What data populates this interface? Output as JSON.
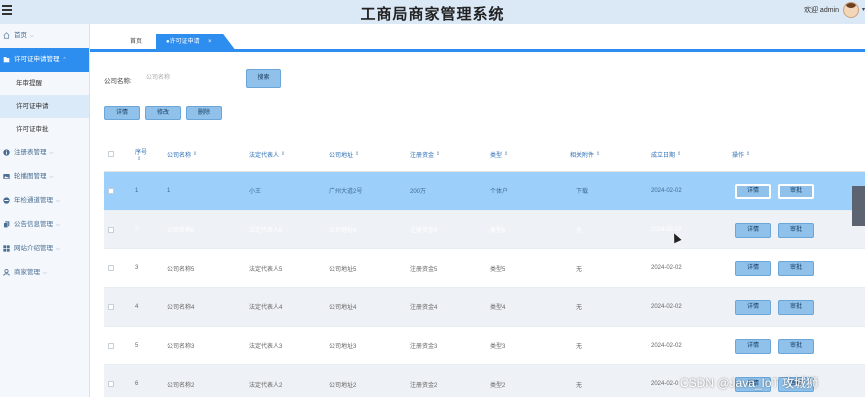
{
  "header": {
    "app_title": "工商局商家管理系统",
    "welcome": "欢迎 admin"
  },
  "sidebar": {
    "items": [
      {
        "label": "首页",
        "icon": "home-icon",
        "active": false,
        "expanded": false
      },
      {
        "label": "许可证申请管理",
        "icon": "folder-icon",
        "active": true,
        "expanded": true,
        "children": [
          {
            "label": "年审提醒",
            "active": false
          },
          {
            "label": "许可证申请",
            "active": true
          },
          {
            "label": "许可证审批",
            "active": false
          }
        ]
      },
      {
        "label": "注册表管理",
        "icon": "info-circle-icon",
        "active": false,
        "expanded": false
      },
      {
        "label": "轮播图管理",
        "icon": "picture-icon",
        "active": false,
        "expanded": false
      },
      {
        "label": "年检通道管理",
        "icon": "minus-circle-icon",
        "active": false,
        "expanded": false
      },
      {
        "label": "公告信息管理",
        "icon": "copy-icon",
        "active": false,
        "expanded": false
      },
      {
        "label": "网站介绍管理",
        "icon": "grid-icon",
        "active": false,
        "expanded": false
      },
      {
        "label": "商家管理",
        "icon": "user-icon",
        "active": false,
        "expanded": false
      }
    ]
  },
  "tabs": [
    {
      "label": "首页",
      "active": false
    },
    {
      "label": "●许可证申请",
      "active": true,
      "close": "×"
    }
  ],
  "search": {
    "label": "公司名称:",
    "placeholder": "公司名称",
    "button": "搜索"
  },
  "actions": {
    "detail": "详情",
    "edit": "修改",
    "delete": "删除"
  },
  "table": {
    "columns": [
      "序号",
      "公司名称",
      "法定代表人",
      "公司地址",
      "注册资金",
      "类型",
      "相关附件",
      "成立日期",
      "操作"
    ],
    "rows": [
      {
        "no": "1",
        "name": "1",
        "rep": "小王",
        "address": "广州大道2号",
        "capital": "200万",
        "type": "个体户",
        "attachment": "下载",
        "date": "2024-02-02",
        "state": "highlight"
      },
      {
        "no": "2",
        "name": "公司名称6",
        "rep": "法定代表人6",
        "address": "公司地址6",
        "capital": "注册资金6",
        "type": "类型6",
        "attachment": "无",
        "date": "2024-02-02",
        "state": "faded"
      },
      {
        "no": "3",
        "name": "公司名称5",
        "rep": "法定代表人5",
        "address": "公司地址5",
        "capital": "注册资金5",
        "type": "类型5",
        "attachment": "无",
        "date": "2024-02-02",
        "state": "normal"
      },
      {
        "no": "4",
        "name": "公司名称4",
        "rep": "法定代表人4",
        "address": "公司地址4",
        "capital": "注册资金4",
        "type": "类型4",
        "attachment": "无",
        "date": "2024-02-02",
        "state": "striped"
      },
      {
        "no": "5",
        "name": "公司名称3",
        "rep": "法定代表人3",
        "address": "公司地址3",
        "capital": "注册资金3",
        "type": "类型3",
        "attachment": "无",
        "date": "2024-02-02",
        "state": "normal"
      },
      {
        "no": "6",
        "name": "公司名称2",
        "rep": "法定代表人2",
        "address": "公司地址2",
        "capital": "注册资金2",
        "type": "类型2",
        "attachment": "无",
        "date": "2024-02-0",
        "state": "striped"
      }
    ],
    "row_actions": {
      "detail": "详情",
      "approve": "审批"
    }
  },
  "watermark": "CSDN @Java_IoT 攻城狮",
  "colors": {
    "accent": "#2e8ef0",
    "button": "#8fc1eb",
    "header": "#dbe8f5",
    "row_highlight": "#9ccff9"
  }
}
